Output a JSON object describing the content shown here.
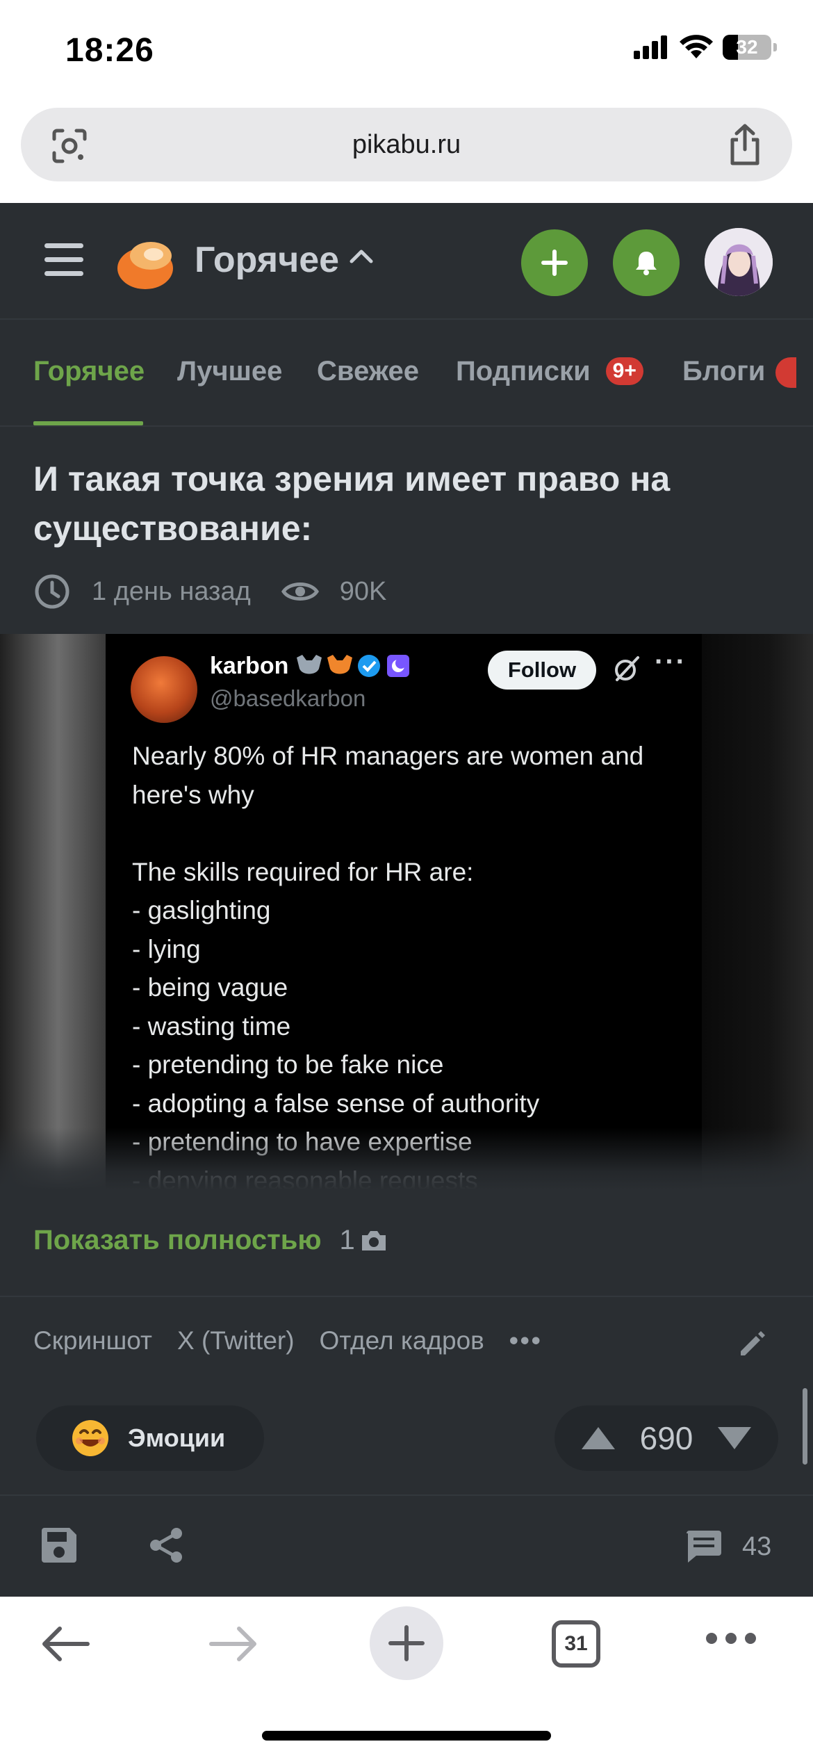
{
  "status_bar": {
    "time": "18:26",
    "battery": "32"
  },
  "browser": {
    "url": "pikabu.ru",
    "open_tabs": "31"
  },
  "header": {
    "title": "Горячее"
  },
  "tabs": [
    {
      "label": "Горячее",
      "active": true
    },
    {
      "label": "Лучшее"
    },
    {
      "label": "Свежее"
    },
    {
      "label": "Подписки",
      "badge": "9+"
    },
    {
      "label": "Блоги"
    }
  ],
  "post": {
    "title": "И такая точка зрения имеет право на существование:",
    "time": "1 день назад",
    "views": "90K",
    "show_full": "Показать полностью",
    "image_count": "1",
    "tags": [
      "Скриншот",
      "X (Twitter)",
      "Отдел кадров"
    ],
    "emotions_label": "Эмоции",
    "rating": "690",
    "comments": "43"
  },
  "tweet": {
    "name": "karbon",
    "handle": "@basedkarbon",
    "follow_label": "Follow",
    "body": "Nearly 80% of HR managers are women and here's why\n\nThe skills required for HR are:\n- gaslighting\n- lying\n- being vague\n- wasting time\n- pretending to be fake nice\n- adopting a false sense of authority\n- pretending to have expertise\n- denying reasonable requests"
  },
  "colors": {
    "accent_green": "#6ea54a",
    "badge_red": "#d23a33",
    "app_bg": "#2a2e32"
  }
}
